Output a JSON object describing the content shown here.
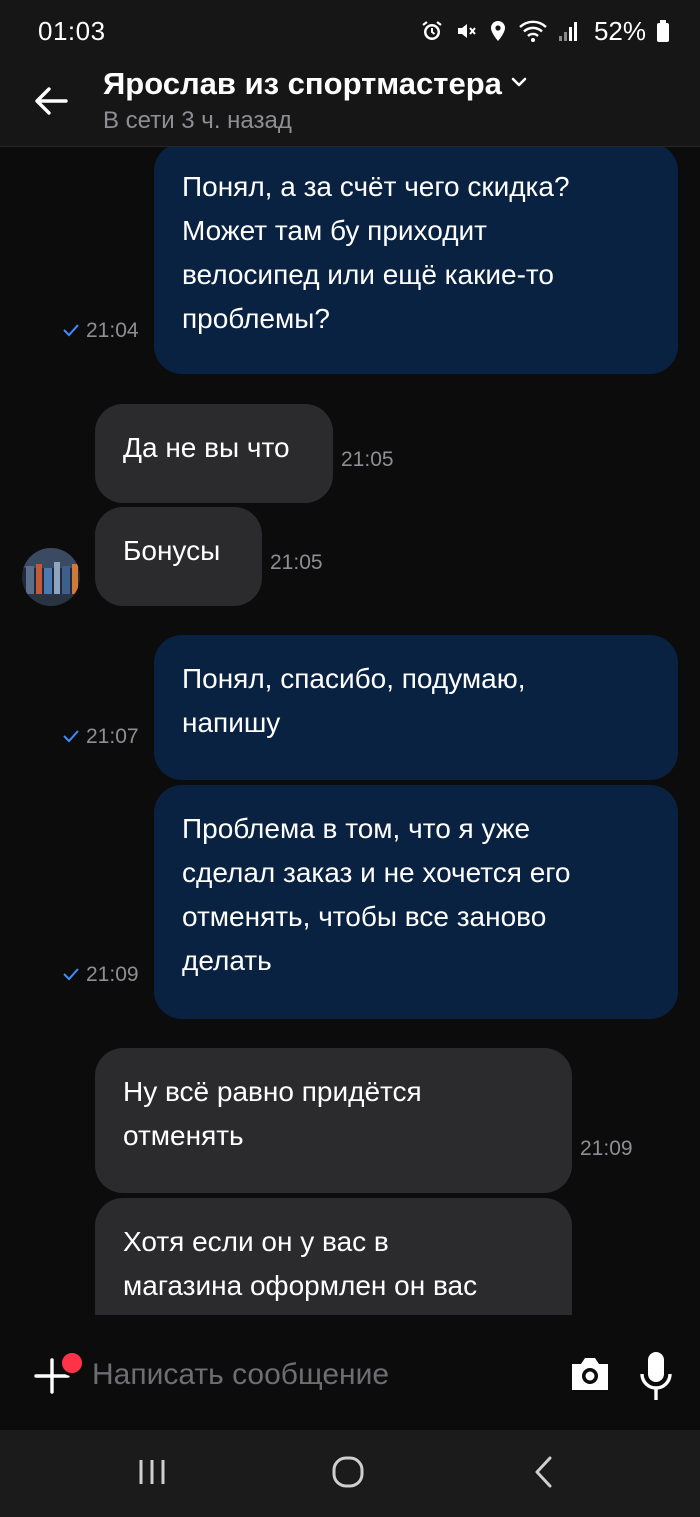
{
  "status_bar": {
    "time": "01:03",
    "battery": "52%",
    "icons": [
      "alarm-icon",
      "mute-icon",
      "location-icon",
      "wifi-icon",
      "signal-icon",
      "battery-icon"
    ]
  },
  "header": {
    "title": "Ярослав из спортмастера",
    "subtitle": "В сети 3 ч. назад",
    "icons": [
      "back-arrow-icon",
      "chevron-down-icon"
    ]
  },
  "messages": [
    {
      "direction": "out",
      "text": "Понял, а за счёт чего скидка?\nМожет там бу приходит\nвелосипед или ещё какие-то\nпроблемы?",
      "time": "21:04",
      "read": true
    },
    {
      "direction": "in",
      "text": "Да не вы что",
      "time": "21:05"
    },
    {
      "direction": "in",
      "text": "Бонусы",
      "time": "21:05"
    },
    {
      "direction": "out",
      "text": "Понял, спасибо, подумаю,\nнапишу",
      "time": "21:07",
      "read": true
    },
    {
      "direction": "out",
      "text": "Проблема в том, что я уже\nсделал заказ и не хочется его\nотменять, чтобы все заново\nделать",
      "time": "21:09",
      "read": true
    },
    {
      "direction": "in",
      "text": "Ну всё равно придётся\nотменять",
      "time": "21:09"
    },
    {
      "direction": "in",
      "text": "Хотя если он у вас в\nмагазина оформлен он вас",
      "time": ""
    }
  ],
  "composer": {
    "placeholder": "Написать сообщение",
    "icons": [
      "plus-icon",
      "camera-icon",
      "microphone-icon"
    ],
    "notification_color": "#ff3347"
  },
  "nav_bar": {
    "icons": [
      "recent-apps-icon",
      "home-icon",
      "back-icon"
    ]
  },
  "colors": {
    "background": "#0c0c0d",
    "outgoing_bubble": "#0a2242",
    "incoming_bubble": "#2b2b2d",
    "read_check": "#3f8cff",
    "muted_text": "#8e8e93"
  }
}
